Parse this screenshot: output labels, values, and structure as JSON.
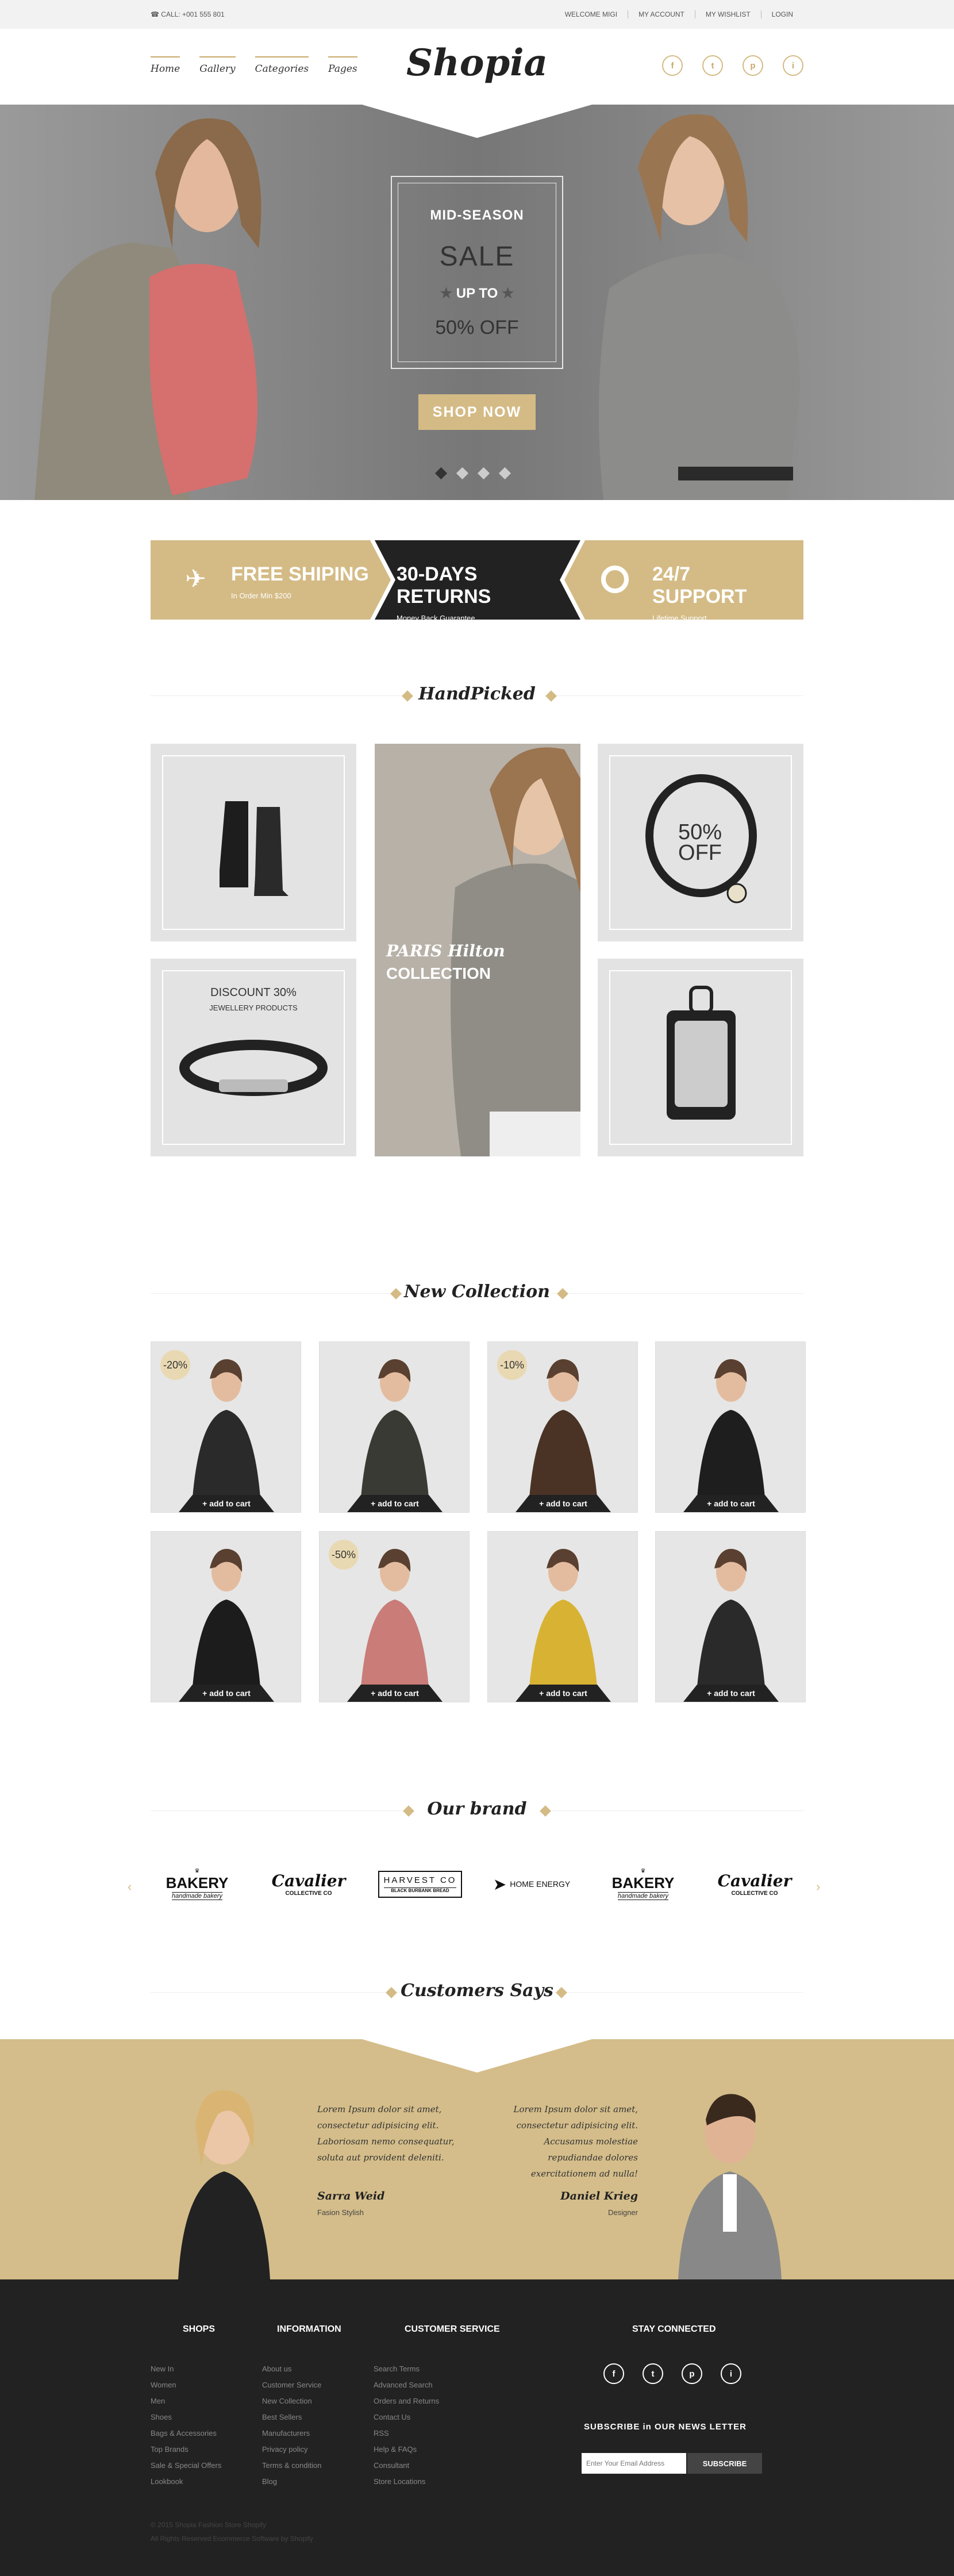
{
  "topbar": {
    "call": "CALL: +001 555 801",
    "links": [
      "WELCOME MIGI",
      "MY ACCOUNT",
      "MY WISHLIST",
      "LOGIN"
    ]
  },
  "header": {
    "nav": [
      "Home",
      "Gallery",
      "Categories",
      "Pages"
    ],
    "logo": "Shopia",
    "social": [
      "f",
      "t",
      "p",
      "i"
    ]
  },
  "hero": {
    "line1": "MID-SEASON",
    "line2": "SALE",
    "line3": "UP TO",
    "line4": "50% OFF",
    "button": "SHOP NOW",
    "slide_count": 4,
    "active_slide": 1
  },
  "features": [
    {
      "title": "FREE SHIPING",
      "sub": "In Order Min $200"
    },
    {
      "title": "30-DAYS RETURNS",
      "sub": "Money Back Guarantee"
    },
    {
      "title": "24/7 SUPPORT",
      "sub": "Lifetime Support"
    }
  ],
  "handpicked": {
    "title": "HandPicked",
    "sale_big": "50%",
    "sale_off": "OFF",
    "discount": "DISCOUNT 30%",
    "discount_sub": "JEWELLERY PRODUCTS",
    "collection_line1": "PARIS Hilton",
    "collection_line2": "COLLECTION"
  },
  "new_collection": {
    "title": "New Collection",
    "cart_label": "+ add to cart",
    "products": [
      {
        "badge": "-20%"
      },
      {
        "badge": ""
      },
      {
        "badge": "-10%"
      },
      {
        "badge": ""
      },
      {
        "badge": ""
      },
      {
        "badge": "-50%"
      },
      {
        "badge": ""
      },
      {
        "badge": ""
      }
    ]
  },
  "brands": {
    "title": "Our brand",
    "items": [
      {
        "name": "BAKERY",
        "sub": "handmade bakery"
      },
      {
        "name": "Cavalier",
        "sub": "COLLECTIVE CO"
      },
      {
        "name": "HARVEST CO",
        "sub": "BLACK BURBANK BREAD"
      },
      {
        "name": "HOME ENERGY",
        "sub": ""
      },
      {
        "name": "BAKERY",
        "sub": "handmade bakery"
      },
      {
        "name": "Cavalier",
        "sub": "COLLECTIVE CO"
      }
    ]
  },
  "testimonials": {
    "title": "Customers Says",
    "items": [
      {
        "text": "Lorem Ipsum dolor sit amet, consectetur adipisicing elit. Laboriosam nemo consequatur, soluta aut provident deleniti.",
        "name": "Sarra Weid",
        "role": "Fasion Stylish"
      },
      {
        "text": "Lorem Ipsum dolor sit amet, consectetur adipisicing elit. Accusamus molestiae repudiandae dolores exercitationem ad nulla!",
        "name": "Daniel Krieg",
        "role": "Designer"
      }
    ]
  },
  "footer": {
    "shops_title": "SHOPS",
    "shops": [
      "New In",
      "Women",
      "Men",
      "Shoes",
      "Bags & Accessories",
      "Top Brands",
      "Sale & Special Offers",
      "Lookbook"
    ],
    "info_title": "INFORMATION",
    "info": [
      "About us",
      "Customer Service",
      "New Collection",
      "Best Sellers",
      "Manufacturers",
      "Privacy policy",
      "Terms & condition",
      "Blog"
    ],
    "service_title": "CUSTOMER SERVICE",
    "service": [
      "Search Terms",
      "Advanced Search",
      "Orders and Returns",
      "Contact Us",
      "RSS",
      "Help & FAQs",
      "Consultant",
      "Store Locations"
    ],
    "connected_title": "STAY CONNECTED",
    "newsletter_title": "SUBSCRIBE in OUR NEWS LETTER",
    "email_placeholder": "Enter Your Email Address",
    "subscribe": "SUBSCRIBE",
    "copyright1": "© 2015 Shopia Fashion Store Shopify",
    "copyright2": "All Rights Reserved Ecommerce Software by Shopify"
  },
  "colors": {
    "accent": "#d4bb85",
    "dark": "#222222",
    "hero_bg": "#8a8a8a"
  }
}
